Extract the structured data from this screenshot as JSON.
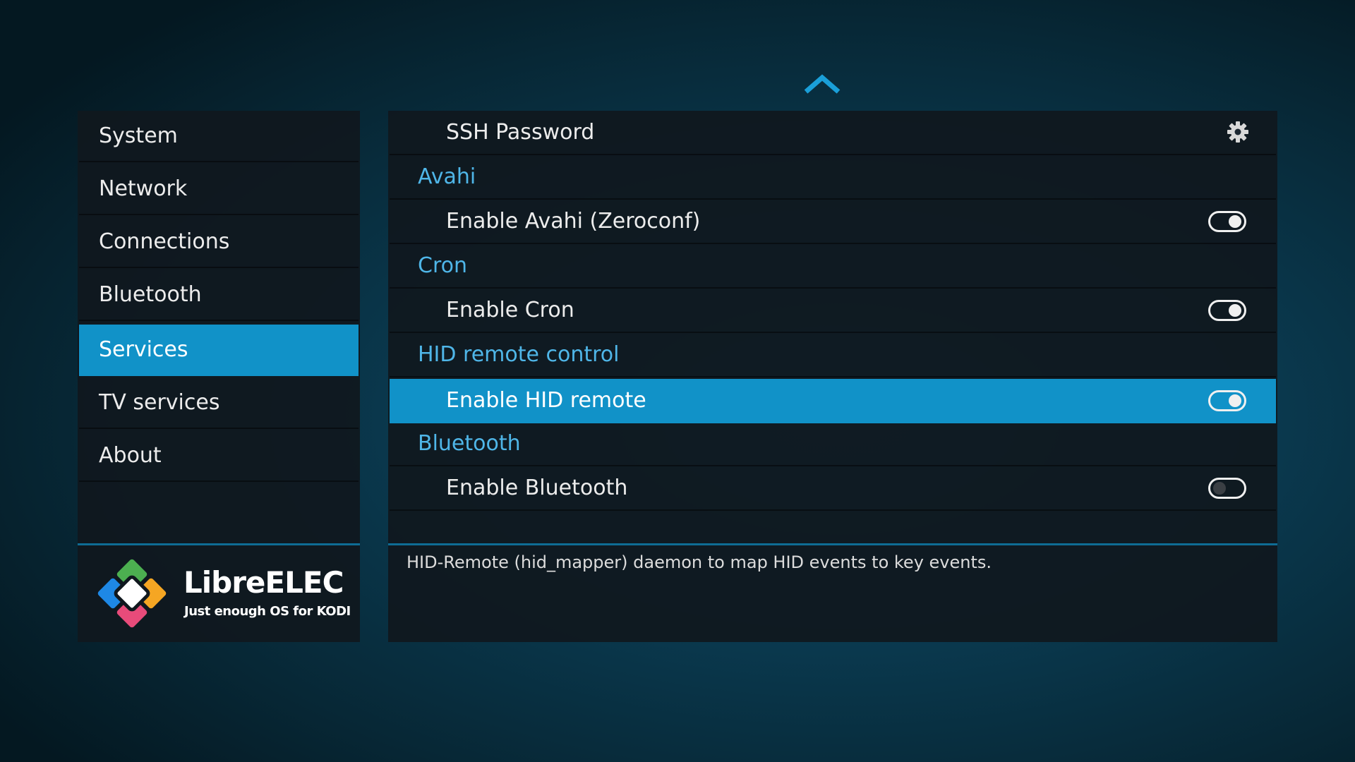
{
  "menu": {
    "items": [
      {
        "label": "System"
      },
      {
        "label": "Network"
      },
      {
        "label": "Connections"
      },
      {
        "label": "Bluetooth"
      },
      {
        "label": "Services",
        "selected": true
      },
      {
        "label": "TV services"
      },
      {
        "label": "About"
      }
    ]
  },
  "logo": {
    "title": "LibreELEC",
    "subtitle": "Just enough OS for KODI"
  },
  "settings": {
    "ssh_password": "SSH Password",
    "avahi_header": "Avahi",
    "avahi_toggle": "Enable Avahi (Zeroconf)",
    "avahi_enabled": true,
    "cron_header": "Cron",
    "cron_toggle": "Enable Cron",
    "cron_enabled": true,
    "hid_header": "HID remote control",
    "hid_toggle": "Enable HID remote",
    "hid_enabled": true,
    "bluetooth_header": "Bluetooth",
    "bluetooth_toggle": "Enable Bluetooth",
    "bluetooth_enabled": false
  },
  "description": "HID-Remote (hid_mapper) daemon to map HID events to key events.",
  "icons": {
    "scroll_up": "chevron-up-icon",
    "ssh_action": "gear-icon"
  },
  "colors": {
    "accent": "#1192c8",
    "header_text": "#4fb6e8"
  }
}
